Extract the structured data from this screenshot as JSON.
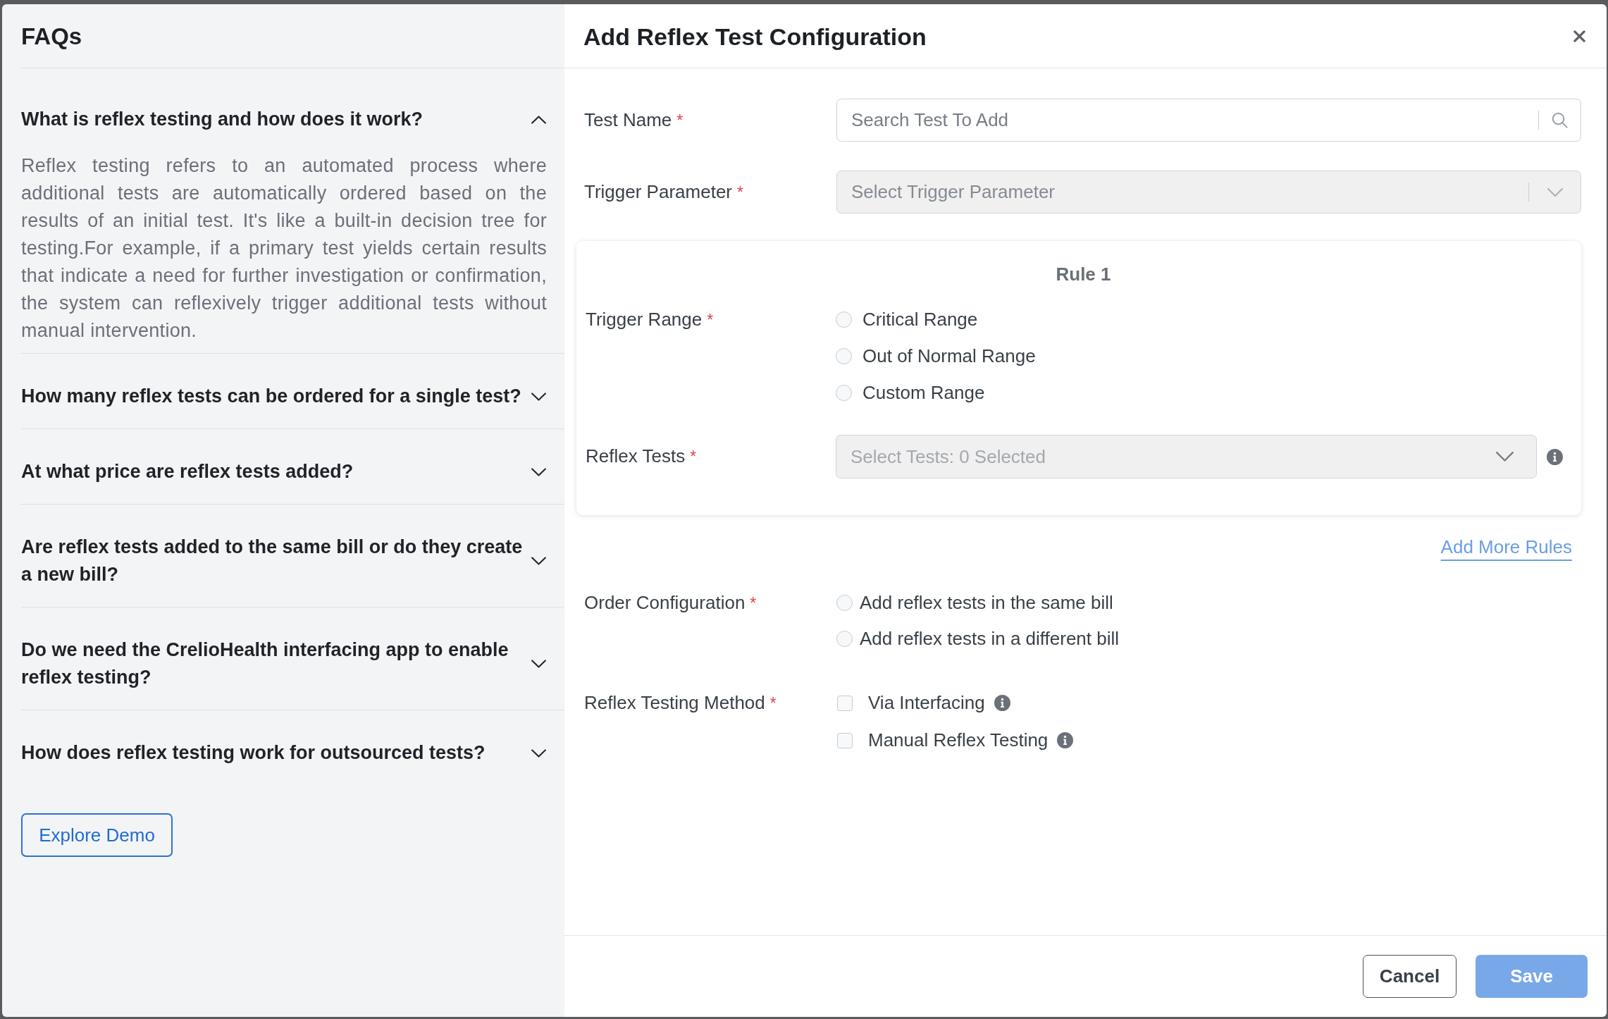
{
  "faq_panel": {
    "title": "FAQs",
    "items": [
      {
        "question": "What is reflex testing and how does it work?",
        "expanded": true,
        "answer": "Reflex testing refers to an automated process where additional tests are automatically ordered based on the results of an initial test. It's like a built-in decision tree for testing.For example, if a primary test yields certain results that indicate a need for further investigation or confirmation, the system can reflexively trigger additional tests without manual intervention."
      },
      {
        "question": "How many reflex tests can be ordered for a single test?",
        "expanded": false
      },
      {
        "question": "At what price are reflex tests added?",
        "expanded": false
      },
      {
        "question": "Are reflex tests added to the same bill or do they create a new bill?",
        "expanded": false
      },
      {
        "question": "Do we need the CrelioHealth interfacing app to enable reflex testing?",
        "expanded": false
      },
      {
        "question": "How does reflex testing work for outsourced tests?",
        "expanded": false
      }
    ],
    "demo_button": "Explore Demo"
  },
  "dialog": {
    "title": "Add Reflex Test Configuration",
    "fields": [
      {
        "kind": "search",
        "label": "Test Name",
        "required_mark": "*",
        "placeholder": "Search Test To Add",
        "disabled": false
      },
      {
        "kind": "select",
        "label": "Trigger Parameter",
        "required_mark": "*",
        "placeholder": "Select Trigger Parameter",
        "disabled": true
      }
    ],
    "rule": {
      "title": "Rule 1",
      "trigger_range": {
        "label": "Trigger Range",
        "required_mark": "*",
        "options": [
          {
            "label": "Critical Range",
            "selected": false
          },
          {
            "label": "Out of Normal Range",
            "selected": false
          },
          {
            "label": "Custom Range",
            "selected": false
          }
        ]
      },
      "reflex_tests": {
        "kind": "multiselect",
        "label": "Reflex Tests",
        "required_mark": "*",
        "placeholder": "Select Tests: 0 Selected",
        "disabled": true,
        "info_icon": true
      }
    },
    "add_rule_link": "Add More Rules",
    "order_configuration": {
      "label": "Order Configuration",
      "required_mark": "*",
      "options": [
        {
          "label": "Add reflex tests in the same bill",
          "selected": false
        },
        {
          "label": "Add reflex tests in a different bill",
          "selected": false
        }
      ]
    },
    "testing_method": {
      "label": "Reflex Testing Method",
      "required_mark": "*",
      "options": [
        {
          "label": "Via Interfacing",
          "checked": false,
          "info_icon": true
        },
        {
          "label": "Manual Reflex Testing",
          "checked": false,
          "info_icon": true
        }
      ]
    },
    "buttons": [
      {
        "kind": "secondary",
        "label": "Cancel",
        "disabled": false
      },
      {
        "kind": "primary",
        "label": "Save",
        "disabled": true
      }
    ]
  }
}
